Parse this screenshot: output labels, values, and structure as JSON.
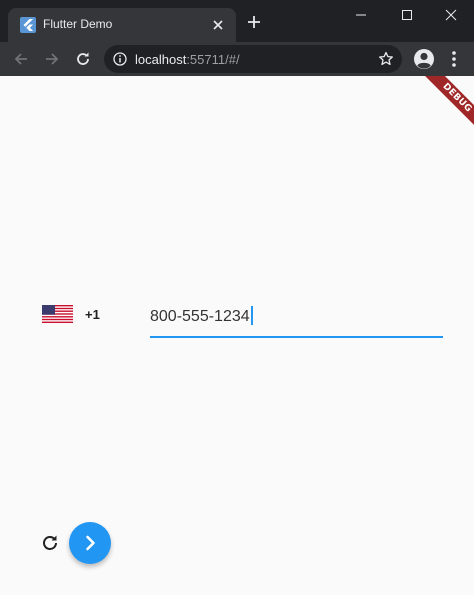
{
  "browser": {
    "tab": {
      "title": "Flutter Demo"
    },
    "address": {
      "host": "localhost",
      "rest": ":55711/#/"
    }
  },
  "app": {
    "country": {
      "flag": "us-flag-icon",
      "dial_code": "+1"
    },
    "phone": {
      "value": "800-555-1234"
    },
    "debug_banner": "DEBUG"
  },
  "colors": {
    "accent": "#2196f3",
    "debug_banner": "#a02727",
    "page_bg": "#fafafa",
    "chrome_dark": "#202124",
    "chrome_toolbar": "#35363a"
  }
}
